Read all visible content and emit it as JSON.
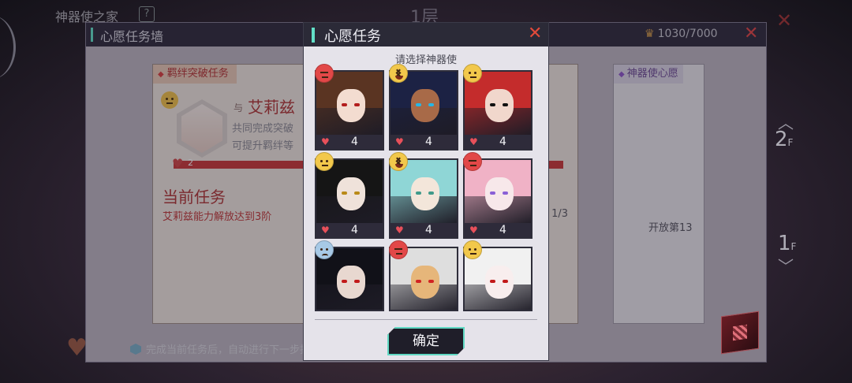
{
  "background": {
    "title": "神器使之家",
    "help_icon": "?",
    "floor_top": "1层",
    "floor_up_2": "2",
    "floor_up_2_suffix": "F",
    "floor_1": "1",
    "floor_1_suffix": "F"
  },
  "wish_wall": {
    "title": "心愿任务墙",
    "coins": "1030/7000",
    "bond_card": {
      "tag": "羁绊突破任务",
      "with_label": "与",
      "character_name": "艾莉兹",
      "desc_line1": "共同完成突破",
      "desc_line2": "可提升羁绊等",
      "bond_level": "2",
      "bond_progress": 1.0,
      "current_task_title": "当前任务",
      "task_text": "艾莉兹能力解放达到3阶",
      "task_progress": "1/3"
    },
    "wish_card": {
      "tag": "神器使心愿",
      "open_text": "开放第13"
    },
    "hint": "完成当前任务后，自动进行下一步指引"
  },
  "modal": {
    "title": "心愿任务",
    "subtitle": "请选择神器使",
    "confirm_label": "确定",
    "tiles": [
      {
        "mood": "angry",
        "value": "4",
        "hair": "#5a3422",
        "skin": "#f3dcd0",
        "eye": "#b31d1d"
      },
      {
        "mood": "excited",
        "value": "4",
        "hair": "#1c2244",
        "skin": "#a86a48",
        "eye": "#25b7e6"
      },
      {
        "mood": "neutral",
        "value": "4",
        "hair": "#c42c2c",
        "skin": "#f1d7cc",
        "eye": "#111111"
      },
      {
        "mood": "neutral",
        "value": "4",
        "hair": "#151515",
        "skin": "#efe2da",
        "eye": "#b98a18"
      },
      {
        "mood": "excited",
        "value": "4",
        "hair": "#8fd6d6",
        "skin": "#f3e6da",
        "eye": "#3f9a8a"
      },
      {
        "mood": "angry",
        "value": "4",
        "hair": "#f0b2c6",
        "skin": "#f7e8ea",
        "eye": "#8a60d6"
      },
      {
        "mood": "sad",
        "value": "",
        "hair": "#111118",
        "skin": "#e8d8d0",
        "eye": "#c21a1a"
      },
      {
        "mood": "angry",
        "value": "",
        "hair": "#dedede",
        "skin": "#e6b67a",
        "eye": "#d12222"
      },
      {
        "mood": "neutral",
        "value": "",
        "hair": "#f1f1f1",
        "skin": "#f8eeee",
        "eye": "#c21a1a"
      }
    ]
  },
  "colors": {
    "accent_teal": "#62e0c8",
    "close_red": "#e24a3a",
    "task_red": "#b03636"
  }
}
